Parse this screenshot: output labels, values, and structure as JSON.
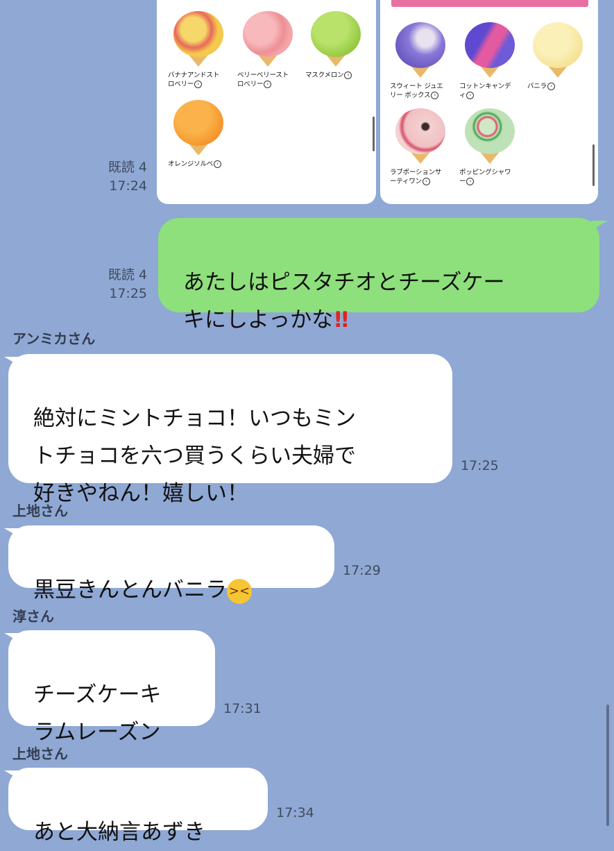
{
  "colors": {
    "background": "#8fa8d4",
    "outgoing": "#8ee07c",
    "incoming": "#ffffff",
    "accent_pink": "#e86fa2"
  },
  "cards": {
    "left": [
      {
        "name": "バナナアンドスト\nロベリー",
        "color": "#f2c44d",
        "accent": "#d94c4c"
      },
      {
        "name": "ベリーベリースト\nロベリー",
        "color": "#f3a5a8",
        "accent": "#d93850"
      },
      {
        "name": "マスクメロン",
        "color": "#9fd24a",
        "accent": "#7cb531"
      },
      {
        "name": "オレンジソルベ",
        "color": "#f79a2a",
        "accent": "#ee7f12"
      }
    ],
    "right": [
      {
        "name": "スウィート ジュエ\nリー ボックス",
        "color": "#7a6bd0",
        "accent": "#e7e0ee"
      },
      {
        "name": "コットンキャンデ\nィ",
        "color": "#6a57d4",
        "accent": "#e45fa6"
      },
      {
        "name": "バニラ",
        "color": "#f7e79c",
        "accent": "#f0d96c"
      },
      {
        "name": "ラブポーションサ\nーティワン",
        "color": "#f1c9c9",
        "accent": "#d23b53"
      },
      {
        "name": "ポッピングシャワ\nー",
        "color": "#bfe1b7",
        "accent": "#e34b6a"
      }
    ]
  },
  "read_top": {
    "read": "既読 4",
    "time": "17:24"
  },
  "msg1": {
    "text": "あたしはピスタチオとチーズケー\nキにしよっかな",
    "emoji": "!!",
    "read": "既読 4",
    "time": "17:25"
  },
  "msg2": {
    "sender": "アンミカさん",
    "text": "絶対にミントチョコ！いつもミン\nトチョコを六つ買うくらい夫婦で\n好きやねん！嬉しい！",
    "time": "17:25"
  },
  "msg3": {
    "sender": "上地さん",
    "text": "黒豆きんとんバニラ",
    "emoji": "😆",
    "time": "17:29"
  },
  "msg4": {
    "sender": "淳さん",
    "text": "チーズケーキ\nラムレーズン",
    "time": "17:31"
  },
  "msg5": {
    "sender": "上地さん",
    "text": "あと大納言あずき",
    "time": "17:34"
  }
}
